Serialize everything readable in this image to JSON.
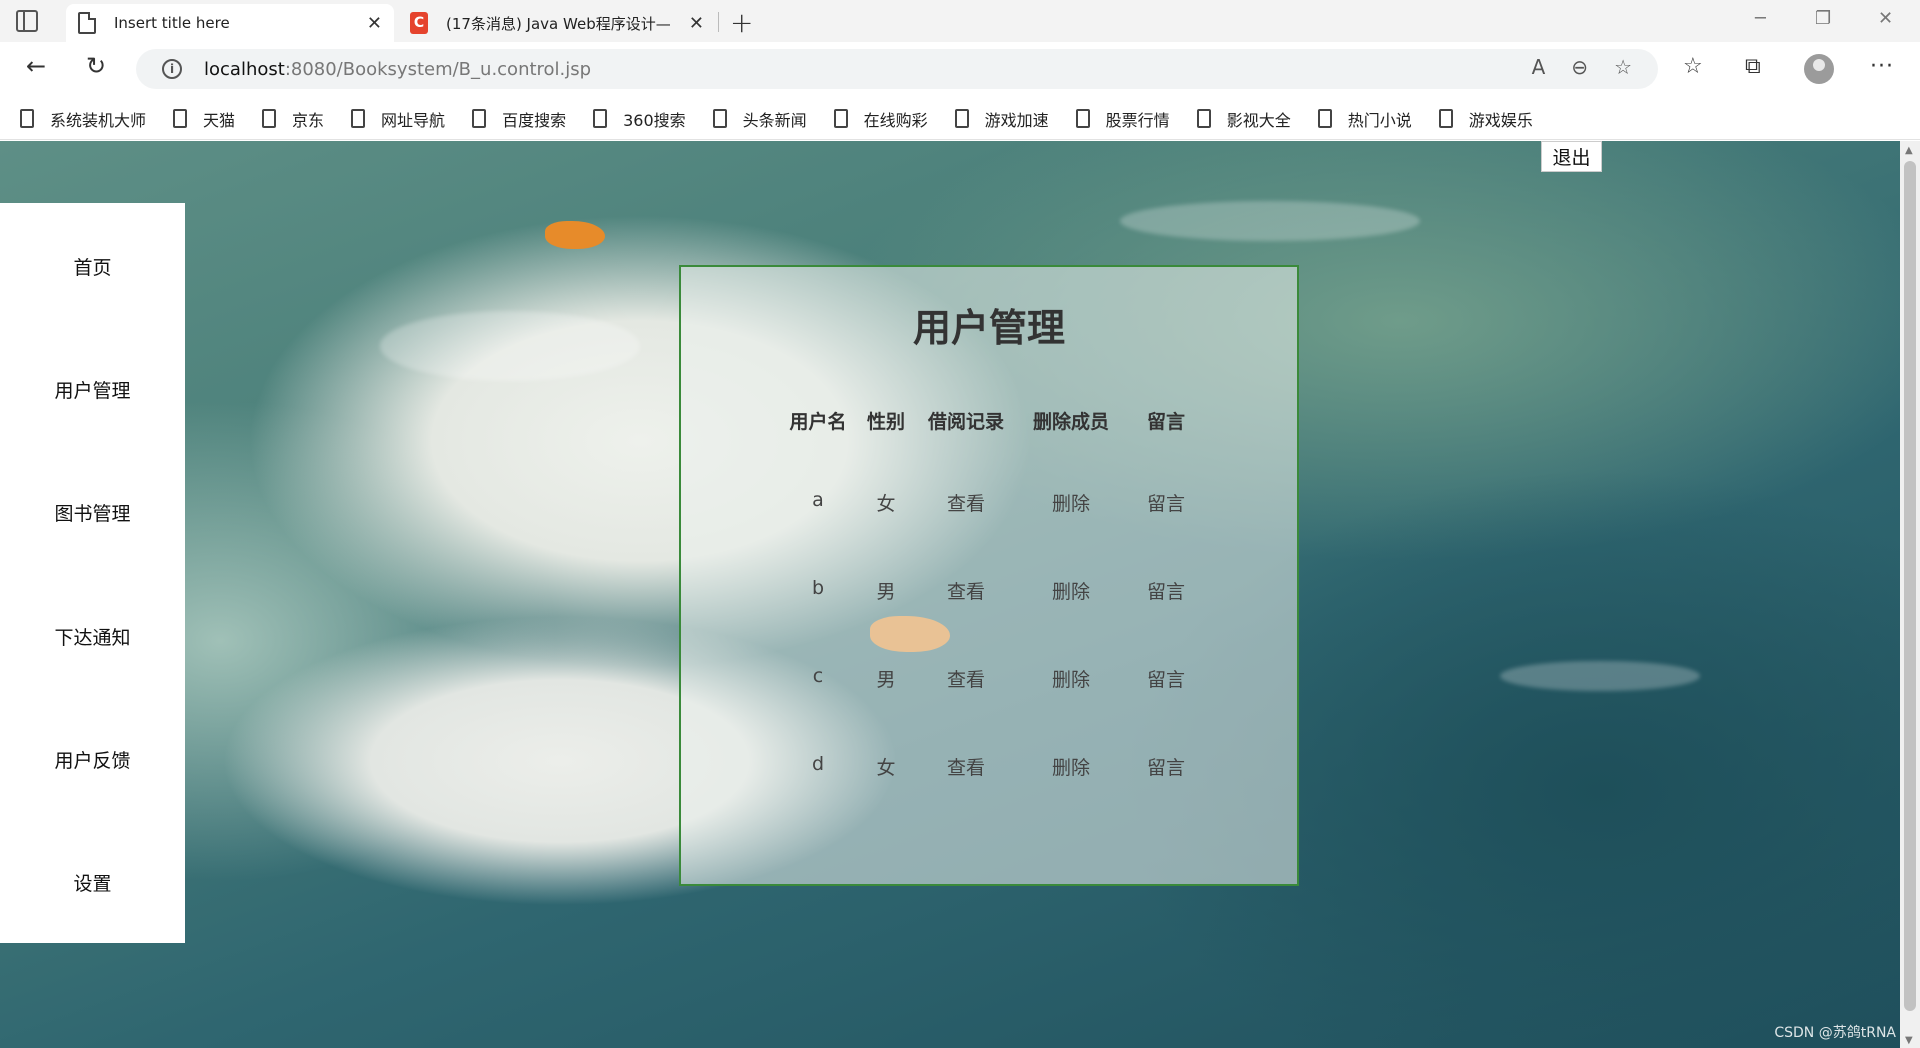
{
  "browser": {
    "tabs": [
      {
        "title": "Insert title here",
        "icon": "page-icon"
      },
      {
        "title": "(17条消息) Java Web程序设计—",
        "icon": "csdn-icon"
      }
    ],
    "address": {
      "host": "localhost",
      "path": ":8080/Booksystem/B_u.control.jsp"
    },
    "bookmarks": [
      "系统装机大师",
      "天猫",
      "京东",
      "网址导航",
      "百度搜索",
      "360搜索",
      "头条新闻",
      "在线购彩",
      "游戏加速",
      "股票行情",
      "影视大全",
      "热门小说",
      "游戏娱乐"
    ]
  },
  "page": {
    "logout_label": "退出",
    "sidebar": [
      "首页",
      "用户管理",
      "图书管理",
      "下达通知",
      "用户反馈",
      "设置"
    ],
    "panel_title": "用户管理",
    "table": {
      "headers": [
        "用户名",
        "性别",
        "借阅记录",
        "删除成员",
        "留言"
      ],
      "rows": [
        [
          "a",
          "女",
          "查看",
          "删除",
          "留言"
        ],
        [
          "b",
          "男",
          "查看",
          "删除",
          "留言"
        ],
        [
          "c",
          "男",
          "查看",
          "删除",
          "留言"
        ],
        [
          "d",
          "女",
          "查看",
          "删除",
          "留言"
        ]
      ]
    },
    "watermark": "CSDN @苏鸽tRNA"
  }
}
